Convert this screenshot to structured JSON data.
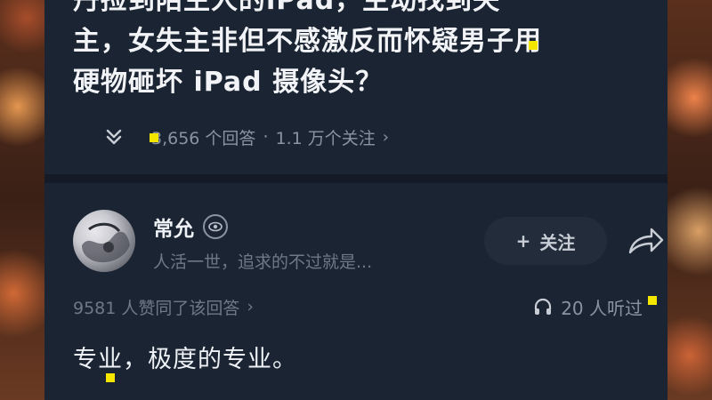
{
  "question": {
    "title_lines": [
      "丹捡到陌生人的iPad，主动找到失",
      "主，女失主非但不感激反而怀疑男子用",
      "硬物砸坏 iPad 摄像头？"
    ],
    "answers_count": "3,656 个回答",
    "separator": "·",
    "followers": "1.1 万个关注",
    "meta_chevron": "›"
  },
  "author": {
    "name": "常允",
    "bio": "人活一世，追求的不过就是...",
    "follow_label": "关注",
    "follow_plus": "+",
    "badge_icon": "eye-badge-icon",
    "avatar_icon": "avatar"
  },
  "stats": {
    "likes": "9581 人赞同了该回答",
    "likes_chevron": "›",
    "listens": "20 人听过"
  },
  "answer": {
    "text": "专业，极度的专业。"
  },
  "colors": {
    "card_bg": "#1b2432",
    "marker": "#f5e600",
    "primary_text": "#eef1f5",
    "muted_text": "#6f7887"
  }
}
